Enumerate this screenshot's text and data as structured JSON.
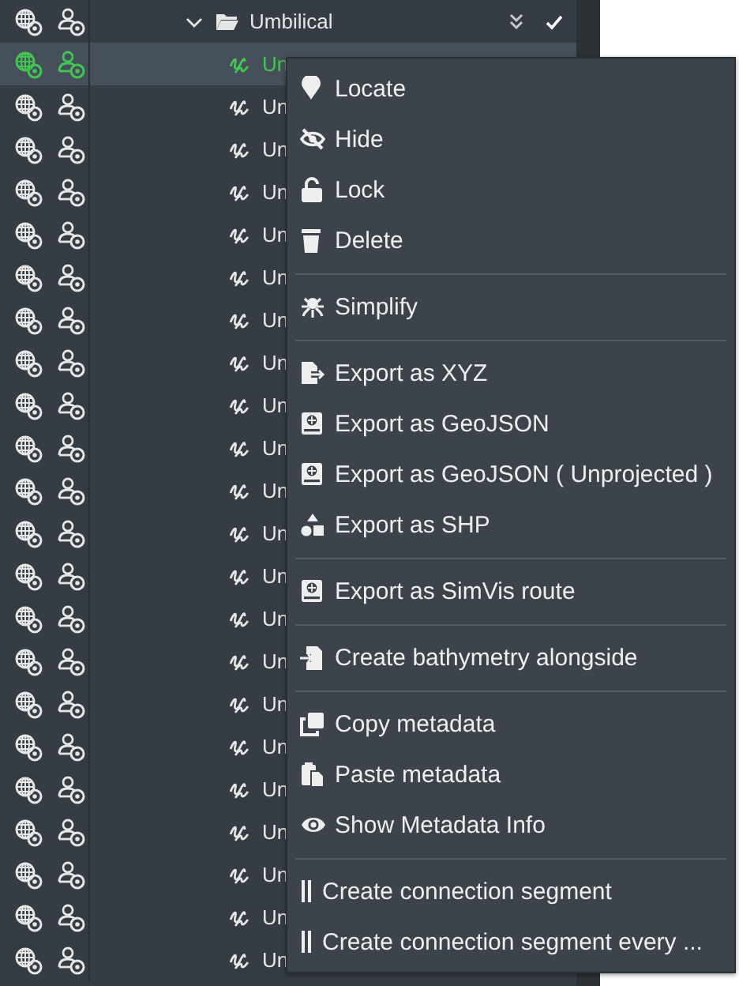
{
  "tree": {
    "label": "Umbilical",
    "expanded": true,
    "selected": false,
    "checked": true,
    "children": [
      {
        "label": "Un",
        "selected": true
      },
      {
        "label": "Un",
        "selected": false
      },
      {
        "label": "Un",
        "selected": false
      },
      {
        "label": "Un",
        "selected": false
      },
      {
        "label": "Un",
        "selected": false
      },
      {
        "label": "Un",
        "selected": false
      },
      {
        "label": "Un",
        "selected": false
      },
      {
        "label": "Un",
        "selected": false
      },
      {
        "label": "Un",
        "selected": false
      },
      {
        "label": "Un",
        "selected": false
      },
      {
        "label": "Un",
        "selected": false
      },
      {
        "label": "Un",
        "selected": false
      },
      {
        "label": "Un",
        "selected": false
      },
      {
        "label": "Un",
        "selected": false
      },
      {
        "label": "Un",
        "selected": false
      },
      {
        "label": "Un",
        "selected": false
      },
      {
        "label": "Un",
        "selected": false
      },
      {
        "label": "Un",
        "selected": false
      },
      {
        "label": "Un",
        "selected": false
      },
      {
        "label": "Un",
        "selected": false
      },
      {
        "label": "Un",
        "selected": false
      },
      {
        "label": "Un",
        "selected": false
      }
    ]
  },
  "context_menu": [
    [
      "Locate",
      "Hide",
      "Lock",
      "Delete"
    ],
    [
      "Simplify"
    ],
    [
      "Export as XYZ",
      "Export as GeoJSON",
      "Export as GeoJSON ( Unprojected )",
      "Export as SHP"
    ],
    [
      "Export as SimVis route"
    ],
    [
      "Create bathymetry alongside"
    ],
    [
      "Copy metadata",
      "Paste metadata",
      "Show Metadata Info"
    ],
    [
      "Create connection segment",
      "Create connection segment every ..."
    ]
  ]
}
